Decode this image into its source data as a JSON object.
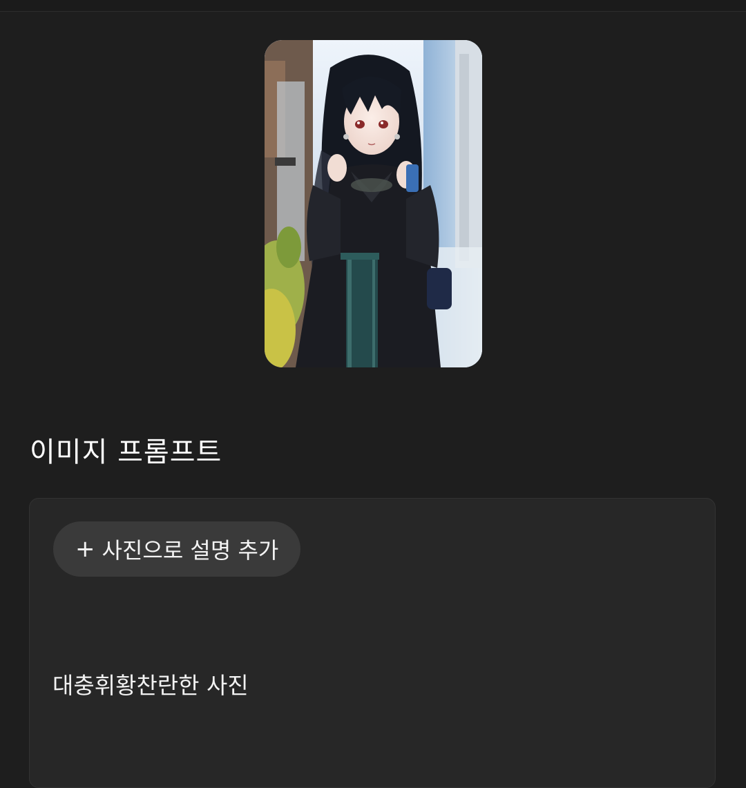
{
  "preview": {
    "image_alt": "Generated anime illustration: girl with dark hair in black hanbok-style dress"
  },
  "section": {
    "title": "이미지 프롬프트"
  },
  "prompt_panel": {
    "add_photo_icon": "plus-icon",
    "add_photo_icon_glyph": "+",
    "add_photo_label": "사진으로 설명 추가",
    "prompt_text": "대충휘황찬란한 사진"
  },
  "colors": {
    "background": "#1e1e1e",
    "panel": "#272727",
    "button": "#3a3a3a",
    "text": "#f2f2f2"
  }
}
